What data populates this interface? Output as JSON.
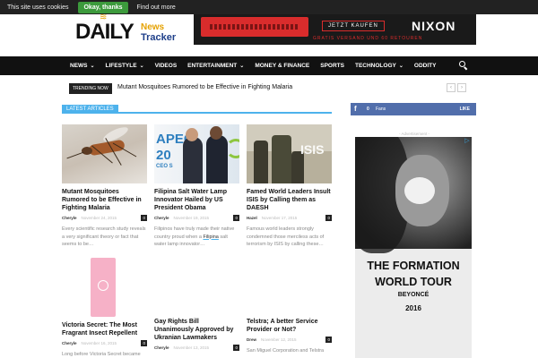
{
  "cookie_bar": {
    "message": "This site uses cookies",
    "ok_label": "Okay, thanks",
    "more_label": "Find out more"
  },
  "logo": {
    "part1": "DAILY",
    "part2": "News",
    "part3": "Tracker"
  },
  "top_ad": {
    "button": "JETZT KAUFEN",
    "brand": "NIXON",
    "shipping": "GRATIS VERSAND UND 60 RETOUREN"
  },
  "nav": {
    "items": [
      {
        "label": "NEWS",
        "dropdown": true
      },
      {
        "label": "LIFESTYLE",
        "dropdown": true
      },
      {
        "label": "VIDEOS",
        "dropdown": false
      },
      {
        "label": "ENTERTAINMENT",
        "dropdown": true
      },
      {
        "label": "MONEY & FINANCE",
        "dropdown": false
      },
      {
        "label": "SPORTS",
        "dropdown": false
      },
      {
        "label": "TECHNOLOGY",
        "dropdown": true
      },
      {
        "label": "ODDITY",
        "dropdown": false
      }
    ]
  },
  "trending": {
    "label": "TRENDING NOW",
    "headline": "Mutant Mosquitoes Rumored to be Effective in Fighting Malaria",
    "prev": "‹",
    "next": "›"
  },
  "latest": {
    "heading": "LATEST ARTICLES",
    "articles": [
      {
        "title": "Mutant Mosquitoes Rumored to be Effective in Fighting Malaria",
        "author": "Cheryle",
        "date": "November 24, 2015",
        "comments": "0",
        "excerpt": "Every scientific research study reveals a very significant theory or fact that seems to be…"
      },
      {
        "title": "Filipina Salt Water Lamp Innovator Hailed by US President Obama",
        "author": "Cheryle",
        "date": "November 19, 2015",
        "comments": "0",
        "excerpt": "Filipinos have truly made their native country proud when a",
        "excerpt_link": "Filipina",
        "excerpt_end": "salt water lamp innovator…"
      },
      {
        "title": "Famed World Leaders Insult ISIS by Calling them as DAESH",
        "author": "Hazel",
        "date": "November 17, 2015",
        "comments": "0",
        "excerpt": "Famous world leaders strongly condemned those merciless acts of terrorism by ISIS by calling these…"
      },
      {
        "title": "Victoria Secret: The Most Fragrant Insect Repellent",
        "author": "Cheryle",
        "date": "November 16, 2015",
        "comments": "0",
        "excerpt": "Long before Victoria Secret became"
      },
      {
        "title": "Gay Rights Bill Unanimously Approved by Ukranian Lawmakers",
        "author": "Cheryle",
        "date": "November 13, 2015",
        "comments": "0",
        "excerpt": ""
      },
      {
        "title": "Telstra; A better Service Provider or Not?",
        "author": "Drew",
        "date": "November 12, 2015",
        "comments": "0",
        "excerpt": "San Miguel Corporation and Telstra"
      }
    ],
    "apec_text": "APEC",
    "apec_year": "20",
    "apec_ceo": "CEO S",
    "isis_text": "ISIS"
  },
  "sidebar": {
    "facebook": {
      "icon": "f",
      "count": "0",
      "label": "Fans",
      "like": "LIKE"
    },
    "ad_label": "- Advertisement -",
    "ad": {
      "headline": "THE FORMATION WORLD TOUR",
      "artist": "BEYONCÉ",
      "year": "2016"
    }
  }
}
